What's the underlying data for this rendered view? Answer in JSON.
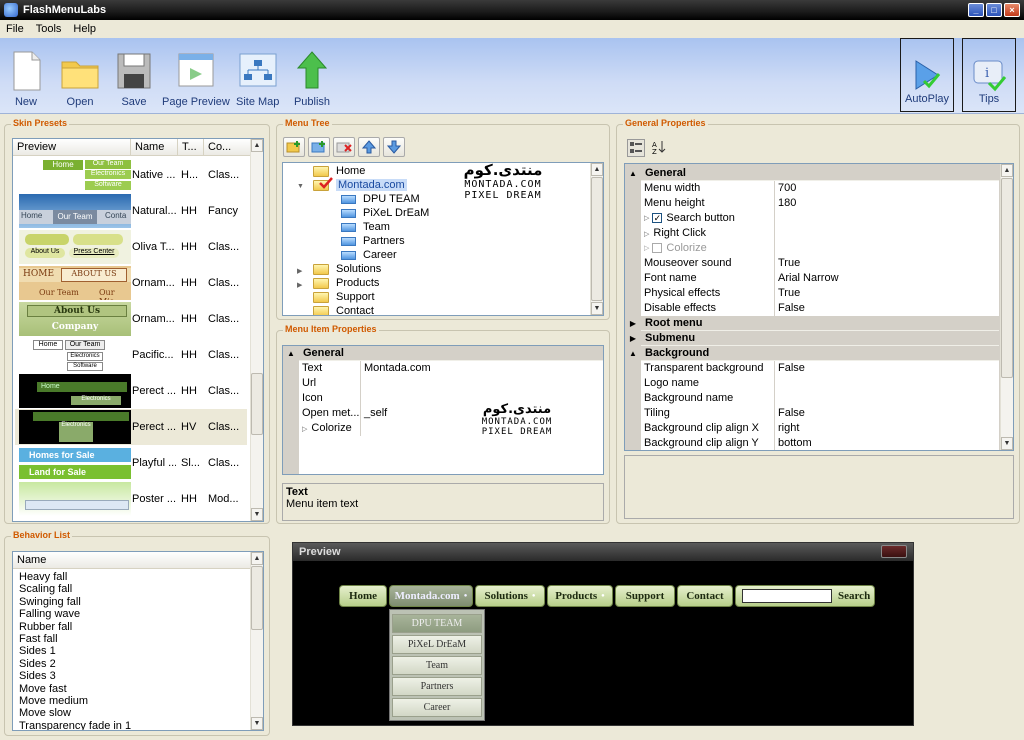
{
  "window": {
    "title": "FlashMenuLabs"
  },
  "menu": {
    "file": "File",
    "tools": "Tools",
    "help": "Help"
  },
  "toolbar": {
    "new": "New",
    "open": "Open",
    "save": "Save",
    "page_preview": "Page Preview",
    "site_map": "Site Map",
    "publish": "Publish",
    "autoplay": "AutoPlay",
    "tips": "Tips"
  },
  "skin_presets": {
    "title": "Skin Presets",
    "columns": [
      "Preview",
      "Name",
      "T...",
      "Co..."
    ],
    "rows": [
      {
        "name": "Native ...",
        "t": "H...",
        "co": "Clas..."
      },
      {
        "name": "Natural...",
        "t": "HH",
        "co": "Fancy"
      },
      {
        "name": "Oliva T...",
        "t": "HH",
        "co": "Clas..."
      },
      {
        "name": "Ornam...",
        "t": "HH",
        "co": "Clas..."
      },
      {
        "name": "Ornam...",
        "t": "HH",
        "co": "Clas..."
      },
      {
        "name": "Pacific...",
        "t": "HH",
        "co": "Clas..."
      },
      {
        "name": "Perect ...",
        "t": "HH",
        "co": "Clas..."
      },
      {
        "name": "Perect ...",
        "t": "HV",
        "co": "Clas..."
      },
      {
        "name": "Playful ...",
        "t": "Sl...",
        "co": "Clas..."
      },
      {
        "name": "Poster ...",
        "t": "HH",
        "co": "Mod..."
      }
    ],
    "thumb_labels": {
      "home": "Home",
      "our_team": "Our Team",
      "electronics": "Electronics",
      "software": "Software",
      "contact": "Conta",
      "about_us": "About Us",
      "press_center": "Press Center",
      "home_caps": "HOME",
      "about_caps": "ABOUT US",
      "our_mis": "Our Mis",
      "about_arrow": "About Us",
      "company": "Company",
      "homes_for_sale": "Homes for Sale",
      "land_for_sale": "Land for Sale"
    }
  },
  "menu_tree": {
    "title": "Menu Tree",
    "items": [
      "Home",
      "Montada.com",
      "DPU TEAM",
      "PiXeL DrEaM",
      "Team",
      "Partners",
      "Career",
      "Solutions",
      "Products",
      "Support",
      "Contact"
    ]
  },
  "watermark": {
    "arabic": "منتدى.كوم",
    "line1": "MONTADA.COM",
    "line2": "PIXEL DREAM"
  },
  "menu_item_properties": {
    "title": "Menu Item Properties",
    "category": "General",
    "rows": [
      {
        "k": "Text",
        "v": "Montada.com"
      },
      {
        "k": "Url",
        "v": ""
      },
      {
        "k": "Icon",
        "v": ""
      },
      {
        "k": "Open met...",
        "v": "_self"
      },
      {
        "k": "Colorize",
        "v": ""
      }
    ],
    "help_title": "Text",
    "help_text": "Menu item text"
  },
  "general_properties": {
    "title": "General Properties",
    "cat_general": "General",
    "rows1": [
      {
        "k": "Menu width",
        "v": "700"
      },
      {
        "k": "Menu height",
        "v": "180"
      },
      {
        "k": "Search button",
        "v": ""
      },
      {
        "k": "Right Click",
        "v": ""
      },
      {
        "k": "Colorize",
        "v": ""
      },
      {
        "k": "Mouseover sound",
        "v": "True"
      },
      {
        "k": "Font name",
        "v": "Arial Narrow"
      },
      {
        "k": "Physical effects",
        "v": "True"
      },
      {
        "k": "Disable effects",
        "v": "False"
      }
    ],
    "cat_root": "Root menu",
    "cat_submenu": "Submenu",
    "cat_background": "Background",
    "rows2": [
      {
        "k": "Transparent background",
        "v": "False"
      },
      {
        "k": "Logo name",
        "v": ""
      },
      {
        "k": "Background name",
        "v": ""
      },
      {
        "k": "Tiling",
        "v": "False"
      },
      {
        "k": "Background clip align X",
        "v": "right"
      },
      {
        "k": "Background clip align Y",
        "v": "bottom"
      }
    ]
  },
  "behavior_list": {
    "title": "Behavior List",
    "column": "Name",
    "items": [
      "Heavy fall",
      "Scaling fall",
      "Swinging fall",
      "Falling wave",
      "Rubber fall",
      "Fast fall",
      "Sides 1",
      "Sides 2",
      "Sides 3",
      "Move fast",
      "Move medium",
      "Move slow",
      "Transparency fade in 1"
    ]
  },
  "preview": {
    "title": "Preview",
    "buttons": [
      "Home",
      "Montada.com",
      "Solutions",
      "Products",
      "Support",
      "Contact"
    ],
    "search_label": "Search",
    "dropdown": [
      "DPU TEAM",
      "PiXeL DrEaM",
      "Team",
      "Partners",
      "Career"
    ]
  },
  "colors": {
    "accent": "#d05a00",
    "toolbar_bg": "#bcd0f4",
    "selection": "#c8dcf8"
  }
}
